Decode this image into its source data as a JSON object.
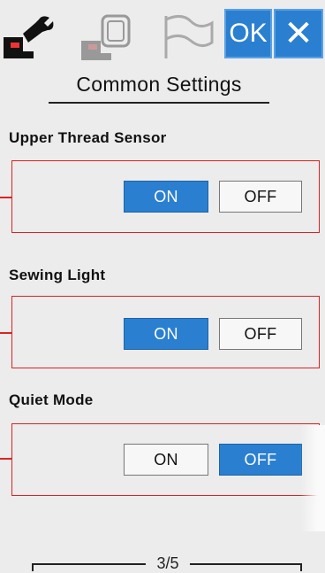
{
  "tabs": [
    {
      "name": "machine-settings"
    },
    {
      "name": "embroidery-settings"
    },
    {
      "name": "general-settings"
    }
  ],
  "toolbar": {
    "ok_label": "OK",
    "close_label": "✕"
  },
  "header": {
    "title": "Common Settings"
  },
  "settings": [
    {
      "label": "Upper Thread Sensor",
      "on_label": "ON",
      "off_label": "OFF",
      "selected": "ON"
    },
    {
      "label": "Sewing Light",
      "on_label": "ON",
      "off_label": "OFF",
      "selected": "ON"
    },
    {
      "label": "Quiet Mode",
      "on_label": "ON",
      "off_label": "OFF",
      "selected": "OFF"
    }
  ],
  "footer": {
    "page_indicator": "3/5"
  },
  "colors": {
    "accent": "#2a7fd0",
    "highlight_border": "#dd2222",
    "background": "#ececec"
  }
}
